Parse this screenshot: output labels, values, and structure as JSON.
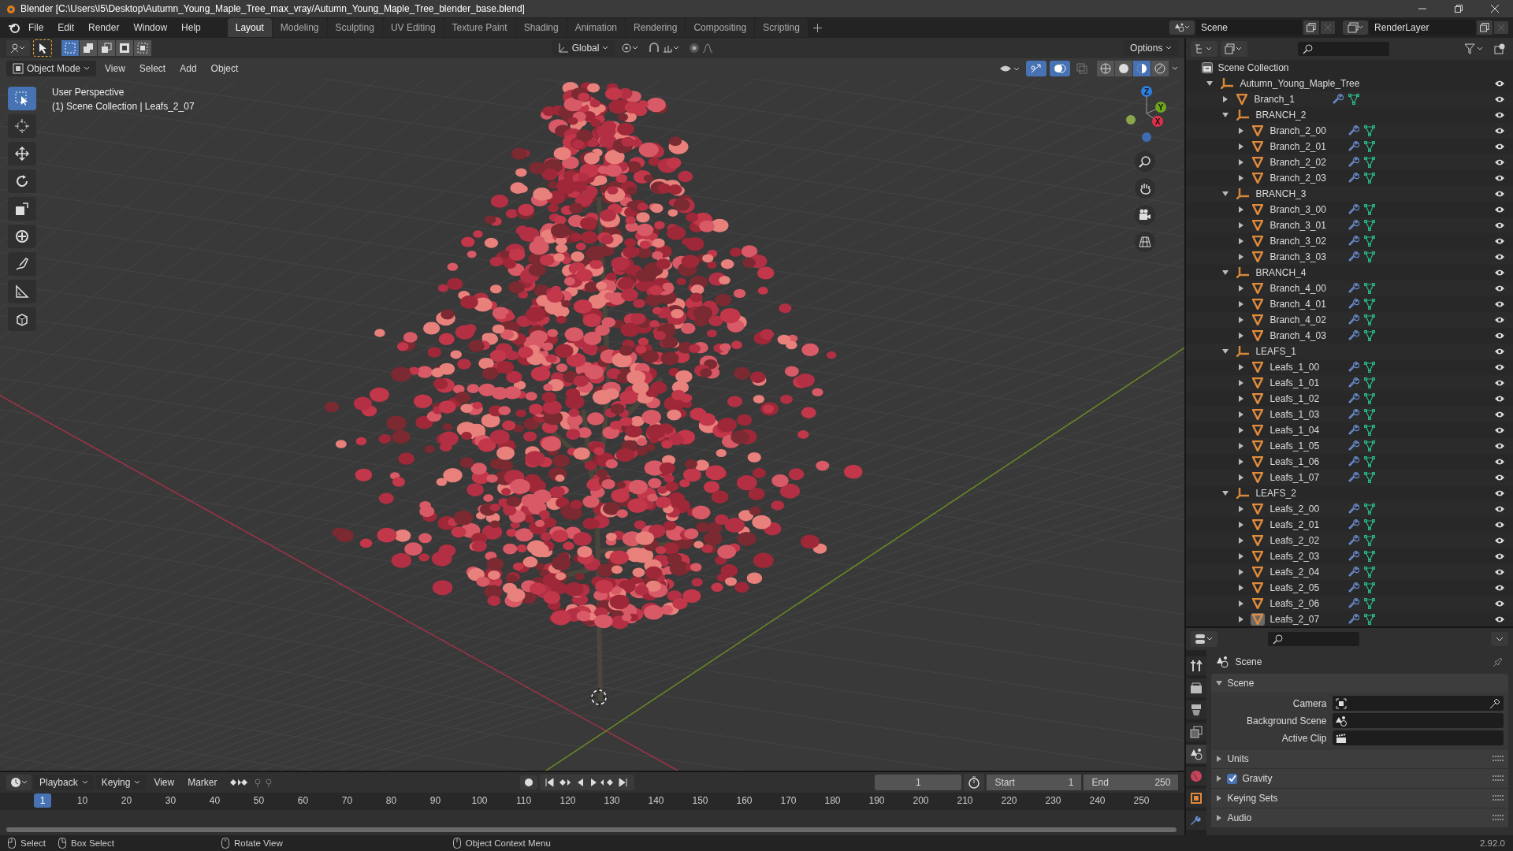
{
  "window": {
    "title": "Blender [C:\\Users\\I5\\Desktop\\Autumn_Young_Maple_Tree_max_vray/Autumn_Young_Maple_Tree_blender_base.blend]"
  },
  "menu": [
    "File",
    "Edit",
    "Render",
    "Window",
    "Help"
  ],
  "workspace_tabs": [
    {
      "label": "Layout",
      "selected": true
    },
    {
      "label": "Modeling",
      "selected": false
    },
    {
      "label": "Sculpting",
      "selected": false
    },
    {
      "label": "UV Editing",
      "selected": false
    },
    {
      "label": "Texture Paint",
      "selected": false
    },
    {
      "label": "Shading",
      "selected": false
    },
    {
      "label": "Animation",
      "selected": false
    },
    {
      "label": "Rendering",
      "selected": false
    },
    {
      "label": "Compositing",
      "selected": false
    },
    {
      "label": "Scripting",
      "selected": false
    }
  ],
  "scene_selector": {
    "scene": "Scene",
    "view_layer": "RenderLayer"
  },
  "viewport": {
    "transform_orientation": "Global",
    "options": "Options",
    "mode": "Object Mode",
    "menus": [
      "View",
      "Select",
      "Add",
      "Object"
    ],
    "overlay_lines": [
      "User Perspective",
      "(1) Scene Collection | Leafs_2_07"
    ],
    "gizmo_axes": [
      {
        "label": "Z",
        "color": "#2f7fe0"
      },
      {
        "label": "Y",
        "color": "#6ea51c"
      },
      {
        "label": "X",
        "color": "#e0304a"
      }
    ]
  },
  "outliner": {
    "root": "Scene Collection",
    "items": [
      {
        "name": "Autumn_Young_Maple_Tree",
        "kind": "collection",
        "expanded": true,
        "selected": false,
        "children": [
          {
            "name": "Branch_1",
            "kind": "mesh",
            "expanded": false,
            "selected": false
          },
          {
            "name": "BRANCH_2",
            "kind": "collection",
            "expanded": true,
            "selected": false,
            "children": [
              {
                "name": "Branch_2_00",
                "kind": "mesh",
                "expanded": false,
                "selected": false
              },
              {
                "name": "Branch_2_01",
                "kind": "mesh",
                "expanded": false,
                "selected": false
              },
              {
                "name": "Branch_2_02",
                "kind": "mesh",
                "expanded": false,
                "selected": false
              },
              {
                "name": "Branch_2_03",
                "kind": "mesh",
                "expanded": false,
                "selected": false
              }
            ]
          },
          {
            "name": "BRANCH_3",
            "kind": "collection",
            "expanded": true,
            "selected": false,
            "children": [
              {
                "name": "Branch_3_00",
                "kind": "mesh",
                "expanded": false,
                "selected": false
              },
              {
                "name": "Branch_3_01",
                "kind": "mesh",
                "expanded": false,
                "selected": false
              },
              {
                "name": "Branch_3_02",
                "kind": "mesh",
                "expanded": false,
                "selected": false
              },
              {
                "name": "Branch_3_03",
                "kind": "mesh",
                "expanded": false,
                "selected": false
              }
            ]
          },
          {
            "name": "BRANCH_4",
            "kind": "collection",
            "expanded": true,
            "selected": false,
            "children": [
              {
                "name": "Branch_4_00",
                "kind": "mesh",
                "expanded": false,
                "selected": false
              },
              {
                "name": "Branch_4_01",
                "kind": "mesh",
                "expanded": false,
                "selected": false
              },
              {
                "name": "Branch_4_02",
                "kind": "mesh",
                "expanded": false,
                "selected": false
              },
              {
                "name": "Branch_4_03",
                "kind": "mesh",
                "expanded": false,
                "selected": false
              }
            ]
          },
          {
            "name": "LEAFS_1",
            "kind": "collection",
            "expanded": true,
            "selected": false,
            "children": [
              {
                "name": "Leafs_1_00",
                "kind": "mesh",
                "expanded": false,
                "selected": false
              },
              {
                "name": "Leafs_1_01",
                "kind": "mesh",
                "expanded": false,
                "selected": false
              },
              {
                "name": "Leafs_1_02",
                "kind": "mesh",
                "expanded": false,
                "selected": false
              },
              {
                "name": "Leafs_1_03",
                "kind": "mesh",
                "expanded": false,
                "selected": false
              },
              {
                "name": "Leafs_1_04",
                "kind": "mesh",
                "expanded": false,
                "selected": false
              },
              {
                "name": "Leafs_1_05",
                "kind": "mesh",
                "expanded": false,
                "selected": false
              },
              {
                "name": "Leafs_1_06",
                "kind": "mesh",
                "expanded": false,
                "selected": false
              },
              {
                "name": "Leafs_1_07",
                "kind": "mesh",
                "expanded": false,
                "selected": false
              }
            ]
          },
          {
            "name": "LEAFS_2",
            "kind": "collection",
            "expanded": true,
            "selected": false,
            "children": [
              {
                "name": "Leafs_2_00",
                "kind": "mesh",
                "expanded": false,
                "selected": false
              },
              {
                "name": "Leafs_2_01",
                "kind": "mesh",
                "expanded": false,
                "selected": false
              },
              {
                "name": "Leafs_2_02",
                "kind": "mesh",
                "expanded": false,
                "selected": false
              },
              {
                "name": "Leafs_2_03",
                "kind": "mesh",
                "expanded": false,
                "selected": false
              },
              {
                "name": "Leafs_2_04",
                "kind": "mesh",
                "expanded": false,
                "selected": false
              },
              {
                "name": "Leafs_2_05",
                "kind": "mesh",
                "expanded": false,
                "selected": false
              },
              {
                "name": "Leafs_2_06",
                "kind": "mesh",
                "expanded": false,
                "selected": false
              },
              {
                "name": "Leafs_2_07",
                "kind": "mesh",
                "expanded": false,
                "selected": true
              }
            ]
          }
        ]
      }
    ]
  },
  "properties": {
    "tabs": [
      {
        "kind": "tool",
        "selected": false
      },
      {
        "kind": "render",
        "selected": false
      },
      {
        "kind": "output",
        "selected": false
      },
      {
        "kind": "view_layer",
        "selected": false
      },
      {
        "kind": "scene",
        "selected": true
      },
      {
        "kind": "world",
        "selected": false
      },
      {
        "kind": "object",
        "selected": false
      },
      {
        "kind": "modifier",
        "selected": false
      }
    ],
    "context": "Scene",
    "panel": {
      "title": "Scene",
      "expanded": true,
      "fields": [
        {
          "label": "Camera",
          "kind": "camera"
        },
        {
          "label": "Background Scene",
          "kind": "scene"
        },
        {
          "label": "Active Clip",
          "kind": "clip"
        }
      ]
    },
    "subpanels": [
      {
        "title": "Units",
        "expanded": false
      },
      {
        "title": "Gravity",
        "expanded": false,
        "checked": true
      },
      {
        "title": "Keying Sets",
        "expanded": false
      },
      {
        "title": "Audio",
        "expanded": false
      }
    ]
  },
  "timeline": {
    "menus": [
      "Playback",
      "Keying",
      "View",
      "Marker"
    ],
    "current_frame": "1",
    "start_label": "Start",
    "start": "1",
    "end_label": "End",
    "end": "250",
    "playhead": "1",
    "ruler_labels": [
      "10",
      "20",
      "30",
      "40",
      "50",
      "60",
      "70",
      "80",
      "90",
      "100",
      "110",
      "120",
      "130",
      "140",
      "150",
      "160",
      "170",
      "180",
      "190",
      "200",
      "210",
      "220",
      "230",
      "240",
      "250"
    ]
  },
  "status_bar": {
    "hints": [
      "Select",
      "Box Select",
      "Rotate View",
      "Object Context Menu"
    ],
    "version": "2.92.0"
  }
}
